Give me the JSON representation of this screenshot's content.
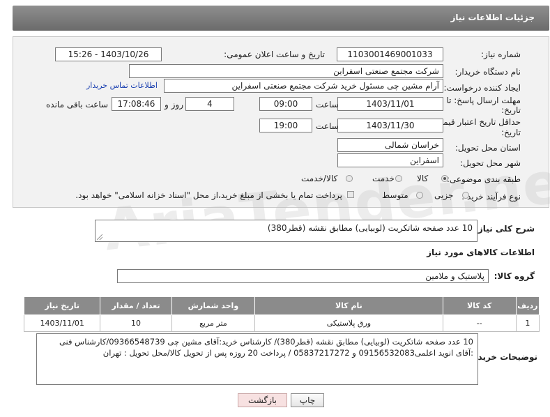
{
  "header": {
    "title": "جزئیات اطلاعات نیاز"
  },
  "form": {
    "need_number": {
      "label": "شماره نیاز:",
      "value": "1103001469001033"
    },
    "announce_datetime": {
      "label": "تاریخ و ساعت اعلان عمومی:",
      "value": "1403/10/26 - 15:26"
    },
    "buyer_org": {
      "label": "نام دستگاه خریدار:",
      "value": "شرکت مجتمع صنعتی اسفراین"
    },
    "requester": {
      "label": "ایجاد کننده درخواست:",
      "value": "آرام مشین چی مسئول خرید شرکت مجتمع صنعتی اسفراین",
      "contact_link": "اطلاعات تماس خریدار"
    },
    "reply_deadline": {
      "label_line1": "مهلت ارسال پاسخ: تا",
      "label_line2": "تاریخ:",
      "date": "1403/11/01",
      "time_label": "ساعت",
      "time": "09:00",
      "days": "4",
      "days_label": "روز و",
      "remaining_time": "17:08:46",
      "remaining_label": "ساعت باقی مانده"
    },
    "price_validity": {
      "label_line1": "حداقل تاریخ اعتبار قیمت: تا",
      "label_line2": "تاریخ:",
      "date": "1403/11/30",
      "time_label": "ساعت",
      "time": "19:00"
    },
    "delivery_province": {
      "label": "استان محل تحویل:",
      "value": "خراسان شمالی"
    },
    "delivery_city": {
      "label": "شهر محل تحویل:",
      "value": "اسفراین"
    },
    "category": {
      "label": "طبقه بندی موضوعی:",
      "options": [
        "کالا",
        "خدمت",
        "کالا/خدمت"
      ],
      "selected": "کالا"
    },
    "purchase_type": {
      "label": "نوع فرآیند خرید :",
      "options": [
        "جزیی",
        "متوسط"
      ],
      "note": "پرداخت تمام یا بخشی از مبلغ خرید،از محل \"اسناد خزانه اسلامی\" خواهد بود."
    }
  },
  "summary": {
    "label": "شرح کلی نیاز:",
    "value": "10 عدد صفحه شاتکریت (لوبیایی) مطابق نقشه (قطر380)"
  },
  "goods_section": {
    "title": "اطلاعات کالاهای مورد نیاز",
    "group_label": "گروه کالا:",
    "group_value": "پلاستیک و ملامین"
  },
  "table": {
    "headers": [
      "ردیف",
      "کد کالا",
      "نام کالا",
      "واحد شمارش",
      "تعداد / مقدار",
      "تاریخ نیاز"
    ],
    "rows": [
      [
        "1",
        "--",
        "ورق پلاستیکی",
        "متر مربع",
        "10",
        "1403/11/01"
      ]
    ]
  },
  "buyer_notes": {
    "label": "توضیحات خریدار:",
    "line1": "10 عدد صفحه شاتکریت (لوبیایی) مطابق نقشه (قطر380)/ کارشناس خرید:آقای مشین چی 09366548739/کارشناس فنی",
    "line2": ":آقای انوید اعلمی09156532083 و 05837217272 / پرداخت 20 روزه پس از تحویل کالا/محل تحویل : تهران"
  },
  "buttons": {
    "print": "چاپ",
    "back": "بازگشت"
  },
  "watermark": {
    "text": "AriaTender.neT"
  },
  "colors": {
    "header_bg": "#7a7a7a",
    "table_header_bg": "#8b8b8b",
    "link": "#1a3fb0",
    "back_button_bg": "#f7e1e1"
  }
}
